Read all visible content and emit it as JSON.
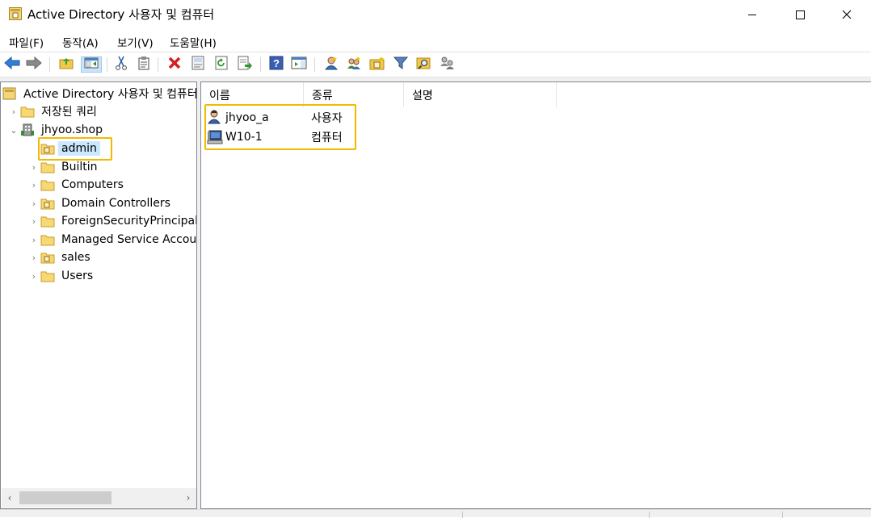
{
  "window": {
    "title": "Active Directory 사용자 및 컴퓨터",
    "minimize_icon": "minimize-icon",
    "maximize_icon": "maximize-icon",
    "close_icon": "close-icon"
  },
  "menu": {
    "items": [
      {
        "label": "파일(F)"
      },
      {
        "label": "동작(A)"
      },
      {
        "label": "보기(V)"
      },
      {
        "label": "도움말(H)"
      }
    ]
  },
  "toolbar": {
    "icons": [
      "back-arrow-icon",
      "forward-arrow-icon",
      "up-folder-icon",
      "show-hide-console-tree-icon",
      "cut-icon",
      "copy-icon",
      "delete-icon",
      "properties-icon",
      "refresh-icon",
      "export-list-icon",
      "help-icon",
      "show-action-pane-icon",
      "new-user-icon",
      "new-group-icon",
      "new-ou-icon",
      "filter-icon",
      "find-icon",
      "add-to-group-icon"
    ]
  },
  "tree": {
    "root": {
      "label": "Active Directory 사용자 및 컴퓨터"
    },
    "saved_queries": {
      "label": "저장된 쿼리"
    },
    "domain": {
      "label": "jhyoo.shop"
    },
    "children": [
      {
        "label": "admin",
        "type": "ou",
        "selected": true
      },
      {
        "label": "Builtin",
        "type": "folder"
      },
      {
        "label": "Computers",
        "type": "folder"
      },
      {
        "label": "Domain Controllers",
        "type": "ou"
      },
      {
        "label": "ForeignSecurityPrincipals",
        "type": "folder"
      },
      {
        "label": "Managed Service Accour",
        "type": "folder"
      },
      {
        "label": "sales",
        "type": "ou"
      },
      {
        "label": "Users",
        "type": "folder"
      }
    ]
  },
  "list": {
    "columns": [
      {
        "label": "이름"
      },
      {
        "label": "종류"
      },
      {
        "label": "설명"
      }
    ],
    "rows": [
      {
        "name": "jhyoo_a",
        "type": "사용자",
        "description": "",
        "icon": "user-icon"
      },
      {
        "name": "W10-1",
        "type": "컴퓨터",
        "description": "",
        "icon": "computer-icon"
      }
    ]
  },
  "colors": {
    "highlight": "#f5b800",
    "selection": "#cce8ff",
    "folder": "#f8d775"
  }
}
